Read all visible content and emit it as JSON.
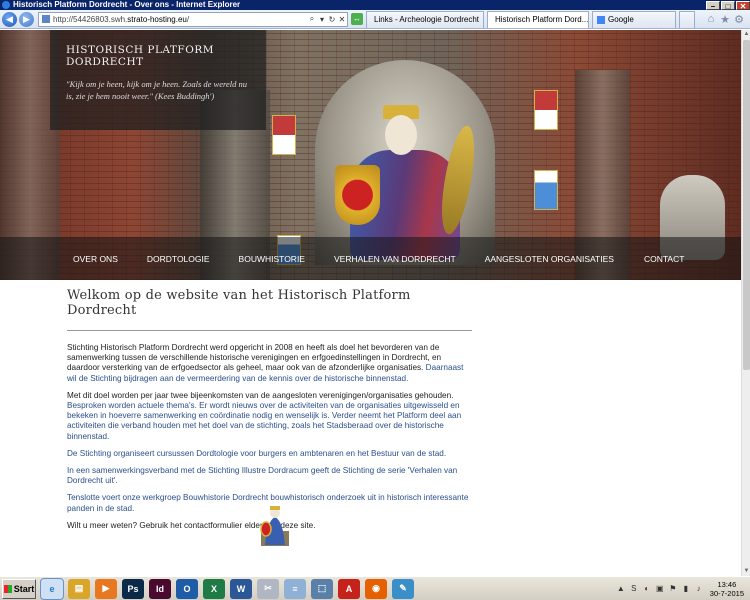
{
  "window": {
    "title": "Historisch Platform Dordrecht - Over ons - Internet Explorer"
  },
  "browser": {
    "back": "◀",
    "forward": "▶",
    "address": {
      "prefix": "http://54426803.swh.",
      "host": "strato-hosting.eu",
      "suffix": "/"
    },
    "address_tools": [
      "⌕",
      "▾",
      "↻",
      "✕"
    ],
    "tabs": [
      {
        "label": "Links - Archeologie Dordrecht",
        "favicon": "#9aa7b8"
      },
      {
        "label": "Historisch Platform Dord...",
        "favicon": "#8a5a3a",
        "close": "✕"
      },
      {
        "label": "Google",
        "favicon": "#4285f4"
      }
    ],
    "right_icons": [
      "⌂",
      "★",
      "⚙"
    ]
  },
  "site": {
    "name": "HISTORISCH PLATFORM DORDRECHT",
    "quote": "\"Kijk om je heen, kijk om je heen. Zoals de wereld nu is, zie je hem nooit weer.\"    (Kees Buddingh')"
  },
  "nav": [
    "OVER ONS",
    "DORDTOLOGIE",
    "BOUWHISTORIE",
    "VERHALEN VAN DORDRECHT",
    "AANGESLOTEN ORGANISATIES",
    "CONTACT"
  ],
  "content": {
    "title": "Welkom op de website van het Historisch Platform Dordrecht",
    "p1a": "Stichting Historisch Platform Dordrecht werd opgericht in 2008 en heeft als doel het bevorderen van de samenwerking tussen de verschillende historische verenigingen en erfgoedinstellingen in Dordrecht, en daardoor versterking van de erfgoedsector als geheel, maar ook van de afzonderlijke organisaties.",
    "p1b": " Daarnaast wil de Stichting bijdragen aan de vermeerdering van de kennis over de historische binnenstad.",
    "p2a": "Met dit doel worden per jaar twee bijeenkomsten van de aangesloten verenigingen/organisaties gehouden.",
    "p2b": " Besproken worden actuele thema's. Er wordt nieuws over de activiteiten van de organisaties uitgewisseld en bekeken in hoeverre samenwerking en coördinatie nodig en wenselijk is. Verder neemt het Platform deel aan activiteiten die verband houden met het doel van de stichting, zoals het Stadsberaad over de historische binnenstad.",
    "p3": "De Stichting organiseert cursussen Dordtologie voor burgers en ambtenaren en het Bestuur van de stad.",
    "p4": "In een samenwerkingsverband met de Stichting Illustre Dordracum geeft de Stichting de serie 'Verhalen van Dordrecht uit'.",
    "p5": "Tenslotte voert onze werkgroep Bouwhistorie Dordrecht bouwhistorisch onderzoek uit in historisch interessante panden in de stad.",
    "p6": "Wilt u meer weten? Gebruik het contactformulier elders op deze site."
  },
  "taskbar": {
    "start": "Start",
    "apps": [
      {
        "name": "internet-explorer",
        "glyph": "e",
        "color": "#1f78d1",
        "active": true
      },
      {
        "name": "file-explorer",
        "glyph": "▤",
        "color": "#d9a52b"
      },
      {
        "name": "media-player",
        "glyph": "▶",
        "color": "#e87722"
      },
      {
        "name": "photoshop",
        "glyph": "Ps",
        "color": "#0b2a4a"
      },
      {
        "name": "indesign",
        "glyph": "Id",
        "color": "#4a0a2f"
      },
      {
        "name": "outlook",
        "glyph": "O",
        "color": "#1f5ca8"
      },
      {
        "name": "excel",
        "glyph": "X",
        "color": "#1e7b45"
      },
      {
        "name": "word",
        "glyph": "W",
        "color": "#2b5797"
      },
      {
        "name": "snipping-tool",
        "glyph": "✂",
        "color": "#b0b7c2"
      },
      {
        "name": "notepad",
        "glyph": "≡",
        "color": "#8fb1d6"
      },
      {
        "name": "network",
        "glyph": "⬚",
        "color": "#5a7fa8"
      },
      {
        "name": "acrobat",
        "glyph": "A",
        "color": "#c4221a"
      },
      {
        "name": "firefox",
        "glyph": "◉",
        "color": "#e66000"
      },
      {
        "name": "paint",
        "glyph": "✎",
        "color": "#3a8fc9"
      }
    ],
    "tray": [
      "▲",
      "S",
      "◐",
      "▣",
      "⚑",
      "▮",
      "♪"
    ],
    "time": "13:46",
    "date": "30-7-2015"
  }
}
